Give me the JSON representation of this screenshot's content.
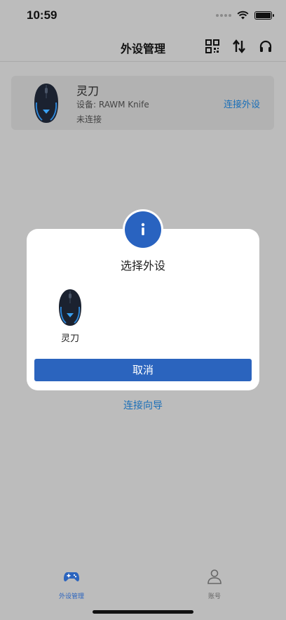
{
  "status_bar": {
    "time": "10:59"
  },
  "nav": {
    "title": "外设管理",
    "icons": [
      "qr-code-icon",
      "sort-icon",
      "headset-icon"
    ]
  },
  "device": {
    "name": "灵刀",
    "model": "设备: RAWM Knife",
    "status": "未连接",
    "action": "连接外设"
  },
  "dialog": {
    "title": "选择外设",
    "options": [
      {
        "label": "灵刀"
      }
    ],
    "cancel": "取消"
  },
  "guide_link": "连接向导",
  "tabs": [
    {
      "label": "外设管理",
      "active": true
    },
    {
      "label": "账号",
      "active": false
    }
  ],
  "colors": {
    "accent": "#2b64be",
    "link": "#1a6fb8",
    "overlay_bg": "#bcbcbc"
  }
}
